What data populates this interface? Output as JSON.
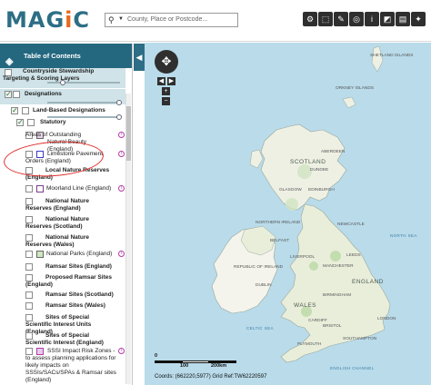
{
  "app": {
    "logo_main": "MAG",
    "logo_i": "i",
    "logo_end": "C"
  },
  "search": {
    "placeholder": "County, Place or Postcode..."
  },
  "toolbar": {
    "icons": [
      "layers-icon",
      "pointer-icon",
      "measure-icon",
      "locate-icon",
      "info-icon",
      "erase-icon",
      "print-icon"
    ]
  },
  "sidebar": {
    "title": "Table of Contents",
    "collapse_glyph": "◀",
    "items": [
      {
        "label": "Countryside Stewardship Targeting & Scoring Layers"
      },
      {
        "label": "Designations"
      },
      {
        "label": "Land-Based Designations"
      },
      {
        "label": "Statutory"
      },
      {
        "label": "Areas of Outstanding Natural Beauty (England)"
      },
      {
        "label": "Limestone Pavement Orders (England)"
      },
      {
        "label": "Local Nature Reserves (England)"
      },
      {
        "label": "Moorland Line (England)"
      },
      {
        "label": "National Nature Reserves (England)"
      },
      {
        "label": "National Nature Reserves (Scotland)"
      },
      {
        "label": "National Nature Reserves (Wales)"
      },
      {
        "label": "National Parks (England)"
      },
      {
        "label": "Ramsar Sites (England)"
      },
      {
        "label": "Proposed Ramsar Sites (England)"
      },
      {
        "label": "Ramsar Sites (Scotland)"
      },
      {
        "label": "Ramsar Sites (Wales)"
      },
      {
        "label": "Sites of Special Scientific Interest Units (England)"
      },
      {
        "label": "Sites of Special Scientific Interest (England)"
      },
      {
        "label": "SSSI Impact Risk Zones - to assess planning applications for likely impacts on SSSIs/SACs/SPAs & Ramsar sites (England)"
      }
    ],
    "colors": {
      "aonb": "#e8d1e8",
      "limestone": "#3b3bc5",
      "moorland": "#7a3d8f",
      "nationalparks": "#cfe8c0",
      "ssi": "#b43aa6"
    }
  },
  "map": {
    "labels": {
      "shetland": "SHETLAND ISLANDS",
      "orkney": "ORKNEY ISLANDS",
      "scotland": "SCOTLAND",
      "aberdeen": "ABERDEEN",
      "dundee": "DUNDEE",
      "glasgow": "GLASGOW",
      "edinburgh": "EDINBURGH",
      "newcastle": "NEWCASTLE",
      "ni": "NORTHERN IRELAND",
      "belfast": "BELFAST",
      "ireland": "REPUBLIC OF IRELAND",
      "dublin": "DUBLIN",
      "leeds": "LEEDS",
      "manchester": "MANCHESTER",
      "liverpool": "LIVERPOOL",
      "england": "ENGLAND",
      "birmingham": "BIRMINGHAM",
      "wales": "WALES",
      "cardiff": "CARDIFF",
      "london": "LONDON",
      "bristol": "BRISTOL",
      "plymouth": "PLYMOUTH",
      "southampton": "SOUTHAMPTON",
      "north_sea": "NORTH SEA",
      "celtic_sea": "CELTIC SEA",
      "channel": "ENGLISH CHANNEL"
    },
    "scale": {
      "s0": "0",
      "s1": "100",
      "s2": "200km"
    },
    "coords_text": "Coords: (662220,5977) Grid Ref:TW62220597"
  }
}
